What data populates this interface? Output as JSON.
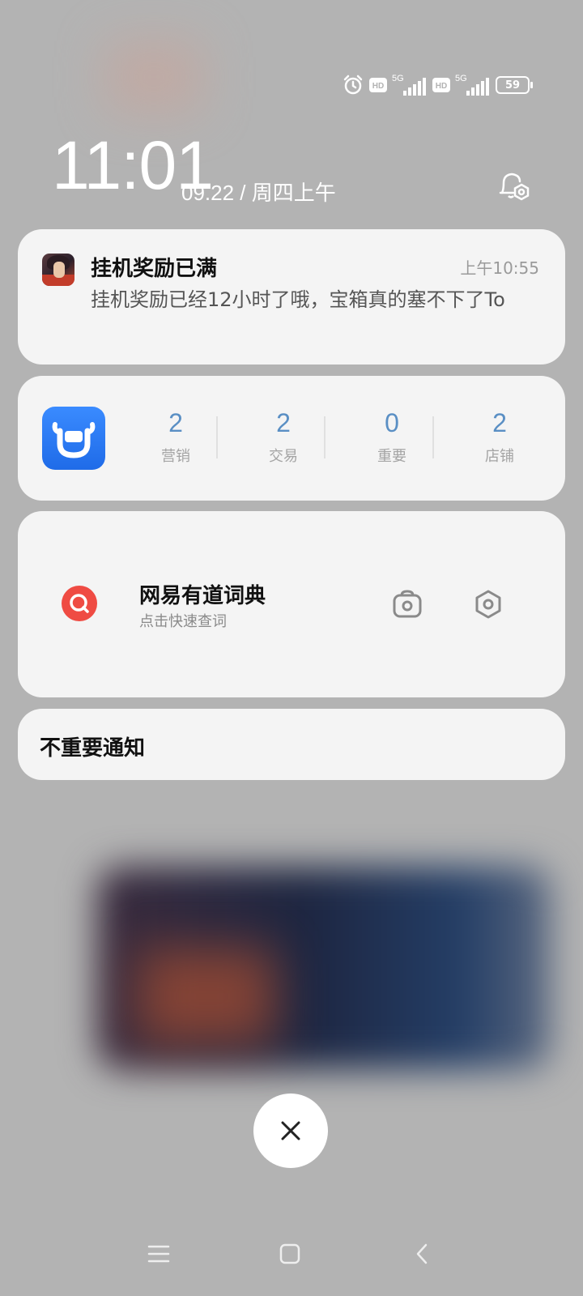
{
  "status_bar": {
    "battery_level": "59",
    "sim1_network": "5G",
    "sim1_hd": "HD",
    "sim2_network": "5G",
    "sim2_hd": "HD",
    "icons": [
      "alarm-icon",
      "hd-icon",
      "signal-icon",
      "hd-icon",
      "signal-icon",
      "battery-icon"
    ]
  },
  "lockscreen": {
    "time": "11:01",
    "date": "09.22 / 周四上午"
  },
  "notifications": {
    "game": {
      "title": "挂机奖励已满",
      "time": "上午10:55",
      "body": "挂机奖励已经12小时了哦，宝箱真的塞不下了To"
    },
    "shop": {
      "stats": [
        {
          "value": "2",
          "label": "营销"
        },
        {
          "value": "2",
          "label": "交易"
        },
        {
          "value": "0",
          "label": "重要"
        },
        {
          "value": "2",
          "label": "店铺"
        }
      ]
    },
    "youdao": {
      "title": "网易有道词典",
      "subtitle": "点击快速查词"
    },
    "low_priority": {
      "label": "不重要通知"
    }
  },
  "colors": {
    "stat_number": "#5a8fc4",
    "youdao_red": "#ef4b43",
    "shop_blue": "#1f6be8"
  }
}
